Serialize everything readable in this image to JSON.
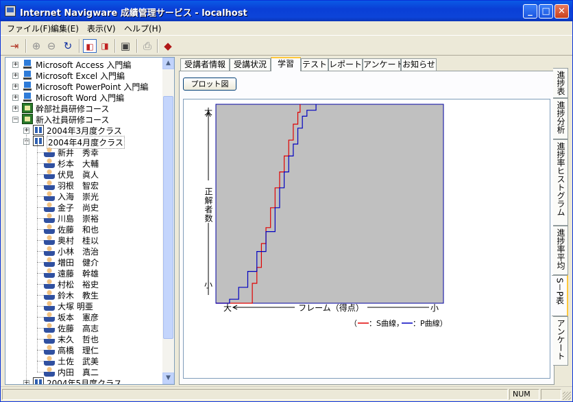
{
  "window": {
    "title": "Internet Navigware 成績管理サービス - localhost",
    "min_label": "_",
    "max_label": "□",
    "close_label": "✕"
  },
  "menu": [
    {
      "label": "ファイル(F)"
    },
    {
      "label": "編集(E)"
    },
    {
      "label": "表示(V)"
    },
    {
      "label": "ヘルプ(H)"
    }
  ],
  "toolbar_icons": [
    "exit-icon",
    "zoom-in-icon",
    "zoom-out-icon",
    "refresh-icon",
    "view-split-icon",
    "view-compare-icon",
    "report-icon",
    "print-icon",
    "book-icon"
  ],
  "tree": {
    "courses": [
      {
        "label": "Microsoft Access 入門編",
        "icon": "pc-icon"
      },
      {
        "label": "Microsoft Excel 入門編",
        "icon": "pc-icon"
      },
      {
        "label": "Microsoft PowerPoint 入門編",
        "icon": "pc-icon"
      },
      {
        "label": "Microsoft Word 入門編",
        "icon": "pc-icon"
      },
      {
        "label": "幹部社員研修コース",
        "icon": "group-icon"
      },
      {
        "label": "新入社員研修コース",
        "icon": "group-icon"
      }
    ],
    "classes": [
      {
        "label": "2004年3月度クラス"
      },
      {
        "label": "2004年4月度クラス"
      },
      {
        "label": "2004年5月度クラス"
      }
    ],
    "students": [
      "新井　秀幸",
      "杉本　大輔",
      "伏見　眞人",
      "羽根　智宏",
      "入海　崇光",
      "金子　尚史",
      "川島　崇裕",
      "佐藤　和也",
      "奥村　桂以",
      "小林　浩治",
      "増田　健介",
      "遠藤　幹雄",
      "村松　裕史",
      "鈴木　教生",
      "大塚 明亜",
      "坂本　憲彦",
      "佐藤　高志",
      "末久　哲也",
      "高橋　理仁",
      "土佐　武美",
      "内田　真二"
    ],
    "expand_plus": "+",
    "expand_minus": "−"
  },
  "tabs": [
    {
      "label": "受講者情報"
    },
    {
      "label": "受講状況"
    },
    {
      "label": "学習"
    },
    {
      "label": "テスト"
    },
    {
      "label": "レポート"
    },
    {
      "label": "アンケート"
    },
    {
      "label": "お知らせ"
    }
  ],
  "plot_button": "プロット図",
  "vtabs": [
    "進捗表",
    "進捗分析",
    "進捗率ヒストグラム",
    "進捗率平均",
    "S－P表",
    "アンケート"
  ],
  "chart_data": {
    "type": "line",
    "ylabel": "正解者数",
    "xlabel": "フレーム（得点）",
    "y_top": "大",
    "y_bottom": "小",
    "x_left": "大",
    "x_right": "小",
    "legend_open": "（",
    "legend_s": "：S曲線，",
    "legend_p": "：P曲線）",
    "colors": {
      "s_curve": "#e00000",
      "p_curve": "#0000c0",
      "plot_bg": "#c0c0c0"
    },
    "s_curve": [
      [
        0.0,
        0.0
      ],
      [
        0.14,
        0.0
      ],
      [
        0.16,
        0.1
      ],
      [
        0.18,
        0.18
      ],
      [
        0.2,
        0.3
      ],
      [
        0.22,
        0.38
      ],
      [
        0.24,
        0.48
      ],
      [
        0.26,
        0.58
      ],
      [
        0.28,
        0.66
      ],
      [
        0.3,
        0.74
      ],
      [
        0.32,
        0.82
      ],
      [
        0.34,
        0.9
      ],
      [
        0.36,
        0.96
      ],
      [
        0.37,
        1.0
      ]
    ],
    "p_curve": [
      [
        0.0,
        0.0
      ],
      [
        0.06,
        0.02
      ],
      [
        0.1,
        0.08
      ],
      [
        0.14,
        0.16
      ],
      [
        0.18,
        0.26
      ],
      [
        0.22,
        0.36
      ],
      [
        0.26,
        0.48
      ],
      [
        0.28,
        0.58
      ],
      [
        0.3,
        0.66
      ],
      [
        0.32,
        0.74
      ],
      [
        0.34,
        0.8
      ],
      [
        0.36,
        0.88
      ],
      [
        0.38,
        0.94
      ],
      [
        0.4,
        0.97
      ],
      [
        0.44,
        1.0
      ]
    ]
  },
  "status": {
    "num": "NUM"
  }
}
